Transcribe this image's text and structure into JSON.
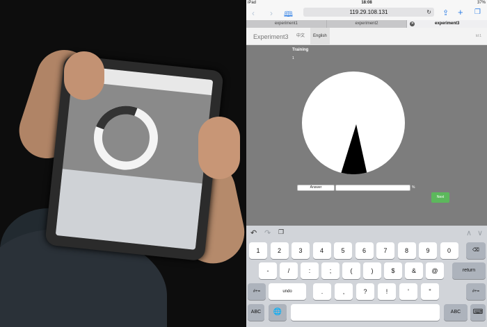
{
  "status_bar": {
    "device": "iPad",
    "time": "18:08",
    "battery": "37%"
  },
  "browser": {
    "url": "119.29.108.131",
    "tabs": [
      {
        "label": "experiment1",
        "active": false
      },
      {
        "label": "experiment2",
        "active": false
      },
      {
        "label": "experiment3",
        "active": true
      }
    ]
  },
  "app": {
    "brand": "Experiment3",
    "languages": [
      "中文",
      "English"
    ],
    "active_language": "English",
    "user_id": "Id:1"
  },
  "task": {
    "heading": "Training",
    "trial_number": "1",
    "pie_fraction": 0.08,
    "answer_button": "Answer",
    "answer_value": "",
    "percent_sign": "%",
    "next_button": "Next",
    "colors": {
      "background": "#7d7d7d",
      "circle": "#ffffff",
      "slice": "#000000",
      "next": "#5cb85c"
    }
  },
  "keyboard": {
    "row1": [
      "1",
      "2",
      "3",
      "4",
      "5",
      "6",
      "7",
      "8",
      "9",
      "0"
    ],
    "row2": [
      "-",
      "/",
      ":",
      ";",
      "(",
      ")",
      "$",
      "&",
      "@"
    ],
    "return_label": "return",
    "row3_left": "#+=",
    "undo_label": "undo",
    "row3_keys": [
      ".",
      ",",
      "?",
      "!",
      "'",
      "\""
    ],
    "row3_right": "#+=",
    "abc_label": "ABC"
  }
}
